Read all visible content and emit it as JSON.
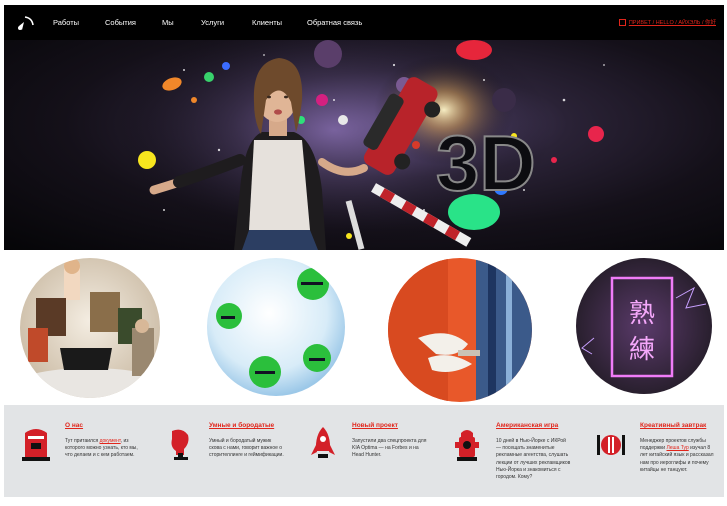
{
  "nav": {
    "items": [
      "Работы",
      "События",
      "Мы",
      "Услуги",
      "Клиенты",
      "Обратная связь"
    ],
    "right_links": "ПРИВЕТ / HELLO / АЙХЭЛЬ / 你好"
  },
  "hero": {
    "text_3d": "3D"
  },
  "circles": [
    {
      "name": "mythology-collage"
    },
    {
      "name": "bubble-with-buttons"
    },
    {
      "name": "orange-hands"
    },
    {
      "name": "neon-sign",
      "glyphs": "熟練"
    }
  ],
  "bottom": [
    {
      "title": "О нас",
      "text_before": "Тут притаился ",
      "highlight": "документ",
      "text_after": ", из которого можно узнать, кто мы, что делаем и с кем работаем.",
      "icon": "mailbox-icon"
    },
    {
      "title": "Умные и бородатые",
      "text_before": "Умный и бородатый мужик скова с нами, говорит важное о сторителлинге и геймификации.",
      "highlight": "",
      "text_after": "",
      "icon": "bearded-head-icon"
    },
    {
      "title": "Новый проект",
      "text_before": "Запустили два спецпроекта для KIA Optima — на Forbes и на Head Hunter.",
      "highlight": "",
      "text_after": "",
      "icon": "rocket-icon"
    },
    {
      "title": "Американская игра",
      "text_before": "10 дней в Нью-Йорке с ИКРой — посещать знаменитые рекламные агентства, слушать лекции от лучших рекламщиков Нью-Йорка и знакомиться с городом. Кому?",
      "highlight": "",
      "text_after": "",
      "icon": "fire-hydrant-icon"
    },
    {
      "title": "Креативный завтрак",
      "text_before": "Менеджер проектов службы поддержки ",
      "highlight": "Леша Тур",
      "text_after": " изучал 8 лет китайский язык и рассказал нам про иероглифы и почему китайцы не танцуют.",
      "icon": "plate-cutlery-icon"
    }
  ],
  "colors": {
    "accent": "#e1251b",
    "nav_bg": "#000000",
    "bottom_bg": "#e2e4e6"
  }
}
